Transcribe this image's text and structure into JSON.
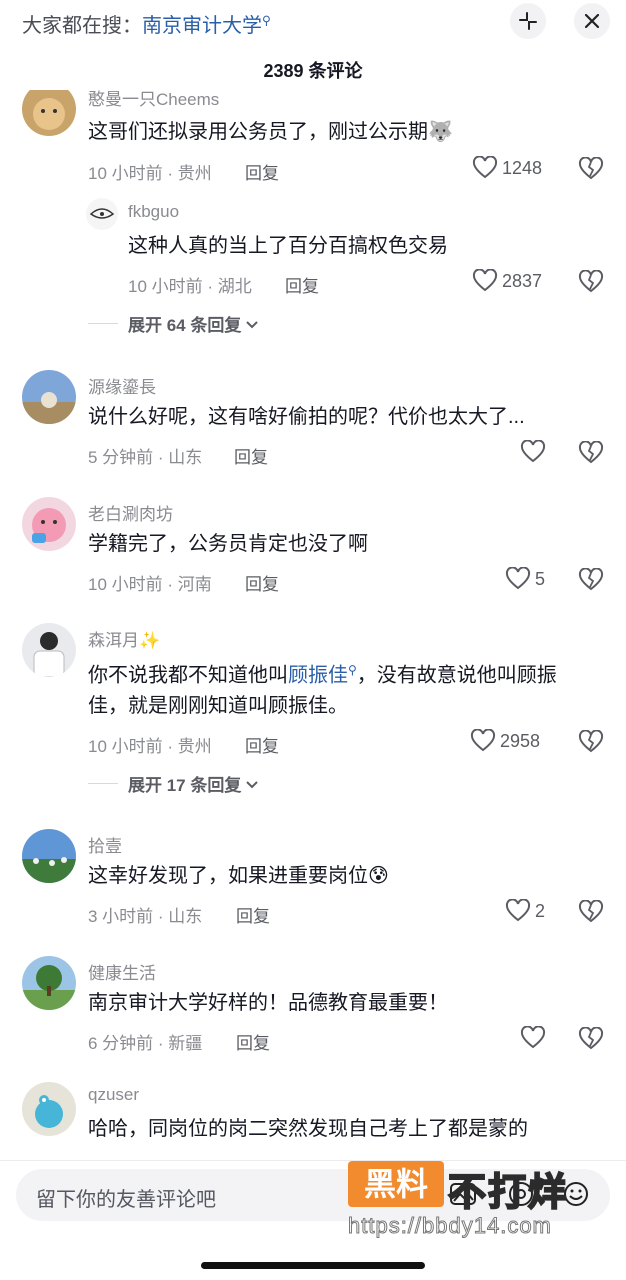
{
  "search": {
    "prefix": "大家都在搜：",
    "term": "南京审计大学"
  },
  "header": {
    "count_title": "2389 条评论"
  },
  "comments": [
    {
      "user": "憨曼一只Cheems",
      "text": "这哥们还拟录用公务员了，刚过公示期",
      "emoji": "🐺",
      "meta": "10 小时前 · 贵州",
      "reply": "回复",
      "likes": "1248"
    },
    {
      "user": "fkbguo",
      "text": "这种人真的当上了百分百搞权色交易",
      "meta": "10 小时前 · 湖北",
      "reply": "回复",
      "likes": "2837"
    },
    {
      "user": "源缘鎏長",
      "text": "说什么好呢，这有啥好偷拍的呢？代价也太大了...",
      "meta": "5 分钟前 · 山东",
      "reply": "回复",
      "likes": ""
    },
    {
      "user": "老白涮肉坊",
      "text": "学籍完了，公务员肯定也没了啊",
      "meta": "10 小时前 · 河南",
      "reply": "回复",
      "likes": "5"
    },
    {
      "user": "森洱月",
      "user_emoji": "✨",
      "text_before": "你不说我都不知道他叫",
      "text_link": "顾振佳",
      "text_after": "，没有故意说他叫顾振",
      "text_line2": "佳，就是刚刚知道叫顾振佳。",
      "meta": "10 小时前 · 贵州",
      "reply": "回复",
      "likes": "2958"
    },
    {
      "user": "拾壹",
      "text": "这幸好发现了，如果进重要岗位",
      "emoji": "😰",
      "meta": "3 小时前 · 山东",
      "reply": "回复",
      "likes": "2"
    },
    {
      "user": "健康生活",
      "text": "南京审计大学好样的！品德教育最重要！",
      "meta": "6 分钟前 · 新疆",
      "reply": "回复",
      "likes": ""
    },
    {
      "user": "qzuser",
      "text": "哈哈，同岗位的岗二突然发现自己考上了都是蒙的"
    }
  ],
  "expand": [
    "展开 64 条回复",
    "展开 17 条回复"
  ],
  "composer": {
    "placeholder": "留下你的友善评论吧"
  },
  "watermark": {
    "badge": "黑料",
    "text": "不打烊",
    "url": "https://bbdy14.com"
  },
  "colors": {
    "link": "#2a5ea8",
    "watermark_badge": "#f28a2e"
  }
}
